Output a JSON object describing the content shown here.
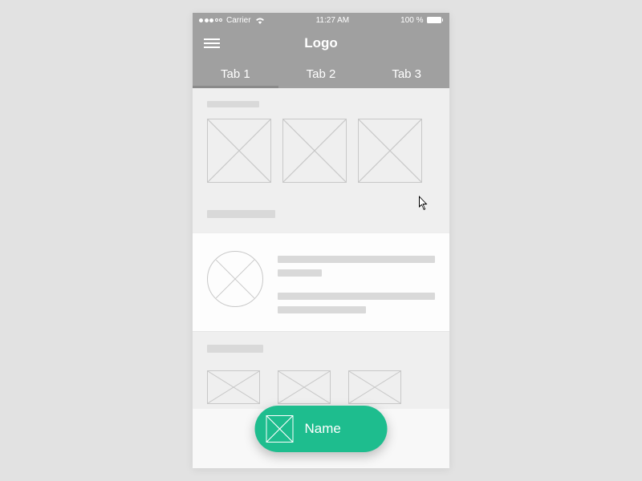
{
  "status": {
    "carrier": "Carrier",
    "time": "11:27 AM",
    "battery_pct": "100 %"
  },
  "header": {
    "title": "Logo"
  },
  "tabs": [
    {
      "label": "Tab 1",
      "active": true
    },
    {
      "label": "Tab 2",
      "active": false
    },
    {
      "label": "Tab 3",
      "active": false
    }
  ],
  "fab": {
    "label": "Name"
  },
  "colors": {
    "chrome_gray": "#a0a0a0",
    "accent_green": "#1ebd8e"
  }
}
